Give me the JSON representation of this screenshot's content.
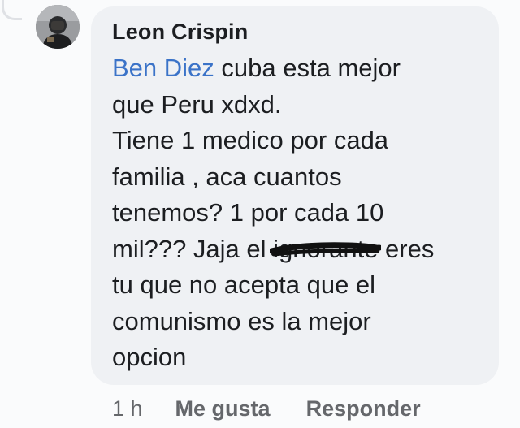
{
  "comment": {
    "author": "Leon Crispin",
    "mention": "Ben Diez",
    "lines": [
      " cuba esta mejor",
      "que Peru xdxd.",
      "Tiene 1 medico por cada",
      "familia , aca cuantos",
      "tenemos? 1 por cada 10",
      "mil??? Jaja el ",
      "ignorante",
      " eres",
      "tu que no acepta que el",
      "comunismo es la mejor",
      "opcion"
    ],
    "timestamp": "1 h",
    "like_label": "Me gusta",
    "reply_label": "Responder"
  },
  "colors": {
    "bubble": "#eff1f4",
    "mention": "#3b73c8",
    "text": "#1c1e21",
    "meta": "#65676b",
    "scribble": "#111111"
  },
  "icons": {
    "avatar": "profile-photo"
  }
}
